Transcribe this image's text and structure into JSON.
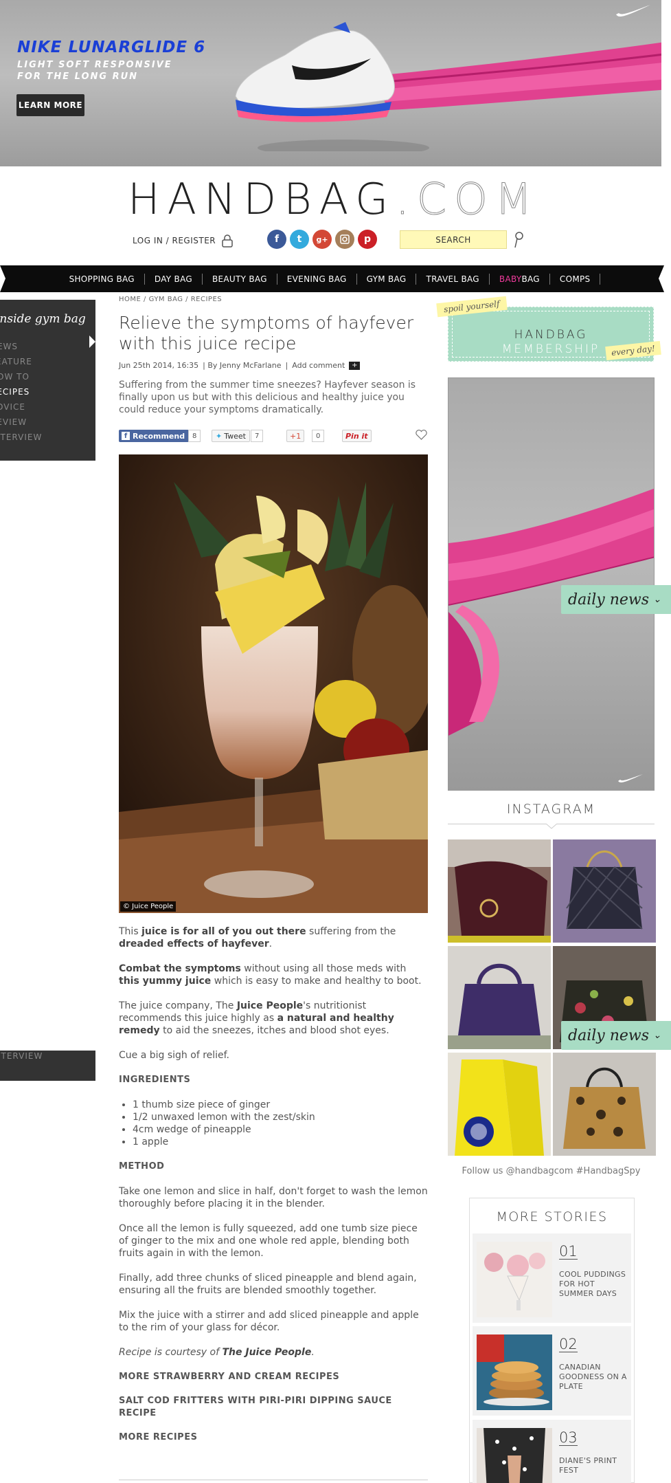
{
  "banner": {
    "title": "NIKE LUNARGLIDE 6",
    "tagline_line1": "LIGHT SOFT RESPONSIVE",
    "tagline_line2": "FOR THE LONG RUN",
    "button": "LEARN MORE"
  },
  "header": {
    "logo_main": "HANDBAG",
    "logo_dot": ".COM",
    "login": "LOG IN / REGISTER",
    "search_label": "SEARCH",
    "social_icons": [
      "facebook-icon",
      "twitter-icon",
      "google-plus-icon",
      "instagram-icon",
      "pinterest-icon"
    ]
  },
  "nav": {
    "items": [
      "SHOPPING BAG",
      "DAY BAG",
      "BEAUTY BAG",
      "EVENING BAG",
      "GYM BAG",
      "TRAVEL BAG"
    ],
    "baby_prefix": "BABY",
    "baby_suffix": "BAG",
    "comps": "COMPS"
  },
  "sidebar": {
    "title": "inside gym bag",
    "items": [
      "NEWS",
      "FEATURE",
      "HOW TO",
      "RECIPES",
      "ADVICE",
      "REVIEW",
      "INTERVIEW"
    ],
    "bottom_item": "INTERVIEW"
  },
  "article": {
    "breadcrumb": "HOME / GYM BAG / RECIPES",
    "headline": "Relieve the symptoms of hayfever with this juice recipe",
    "date": "Jun 25th 2014, 16:35",
    "byline": "| By Jenny McFarlane",
    "comment_link": "Add comment",
    "standfirst": "Suffering from the summer time sneezes? Hayfever season is finally upon us but with this delicious and healthy juice you could reduce your symptoms dramatically.",
    "share": {
      "fb_label": "Recommend",
      "fb_count": "8",
      "tw_label": "Tweet",
      "tw_count": "7",
      "gp_label": "+1",
      "gp_count": "0",
      "pin_label": "Pin it"
    },
    "image_credit": "© Juice People",
    "p1_a": "This ",
    "p1_b": "juice is for all of you out there",
    "p1_c": " suffering from the ",
    "p1_d": "dreaded effects of hayfever",
    "p1_e": ".",
    "p2_a": "Combat the symptoms",
    "p2_b": " without using all those meds with ",
    "p2_c": "this yummy juice",
    "p2_d": " which is easy to make and healthy to boot.",
    "p3_a": "The juice company, The ",
    "p3_b": "Juice People",
    "p3_c": "'s nutritionist recommends this juice highly as ",
    "p3_d": "a natural and healthy remedy",
    "p3_e": " to aid the sneezes, itches and blood shot eyes.",
    "p4": "Cue a big sigh of relief.",
    "ingredients_heading": "INGREDIENTS",
    "ingredients": [
      "1 thumb size piece of ginger",
      "1/2 unwaxed lemon with the zest/skin",
      "4cm wedge of pineapple",
      "1 apple"
    ],
    "method_heading": "METHOD",
    "method": [
      "Take one lemon and slice in half, don't forget to wash the lemon thoroughly before placing it in the blender.",
      "Once all the lemon is fully squeezed, add one tumb size piece of ginger to the mix and one whole red apple, blending both fruits again in with the lemon.",
      "Finally, add three chunks of sliced pineapple and blend again, ensuring all the fruits are blended smoothly together.",
      "Mix the juice with a stirrer and add sliced pineapple and apple to the rim of your glass for décor."
    ],
    "courtesy_a": "Recipe is courtesy of ",
    "courtesy_b": "The Juice People",
    "courtesy_c": ".",
    "more_links": [
      "MORE STRAWBERRY AND CREAM RECIPES",
      "SALT COD FRITTERS WITH PIRI-PIRI DIPPING SAUCE RECIPE",
      "MORE RECIPES"
    ]
  },
  "right": {
    "spoil_tag": "spoil yourself",
    "membership_title": "HANDBAG",
    "membership_sub": "MEMBERSHIP",
    "every_day_tag": "every day!",
    "daily_news": "daily news",
    "instagram_title": "INSTAGRAM",
    "follow": "Follow us @handbagcom #HandbagSpy",
    "more_stories_title": "MORE STORIES",
    "stories": [
      {
        "num": "01",
        "title": "COOL PUDDINGS FOR HOT SUMMER DAYS"
      },
      {
        "num": "02",
        "title": "CANADIAN GOODNESS ON A PLATE"
      },
      {
        "num": "03",
        "title": "DIANE'S PRINT FEST"
      }
    ]
  },
  "colors": {
    "nike_blue": "#1a3fd6",
    "mint": "#a8dcc4",
    "note_yellow": "#fdf6a6",
    "search_yellow": "#fff9b8",
    "nav_black": "#0c0c0c",
    "baby_pink": "#ef3b9c"
  }
}
